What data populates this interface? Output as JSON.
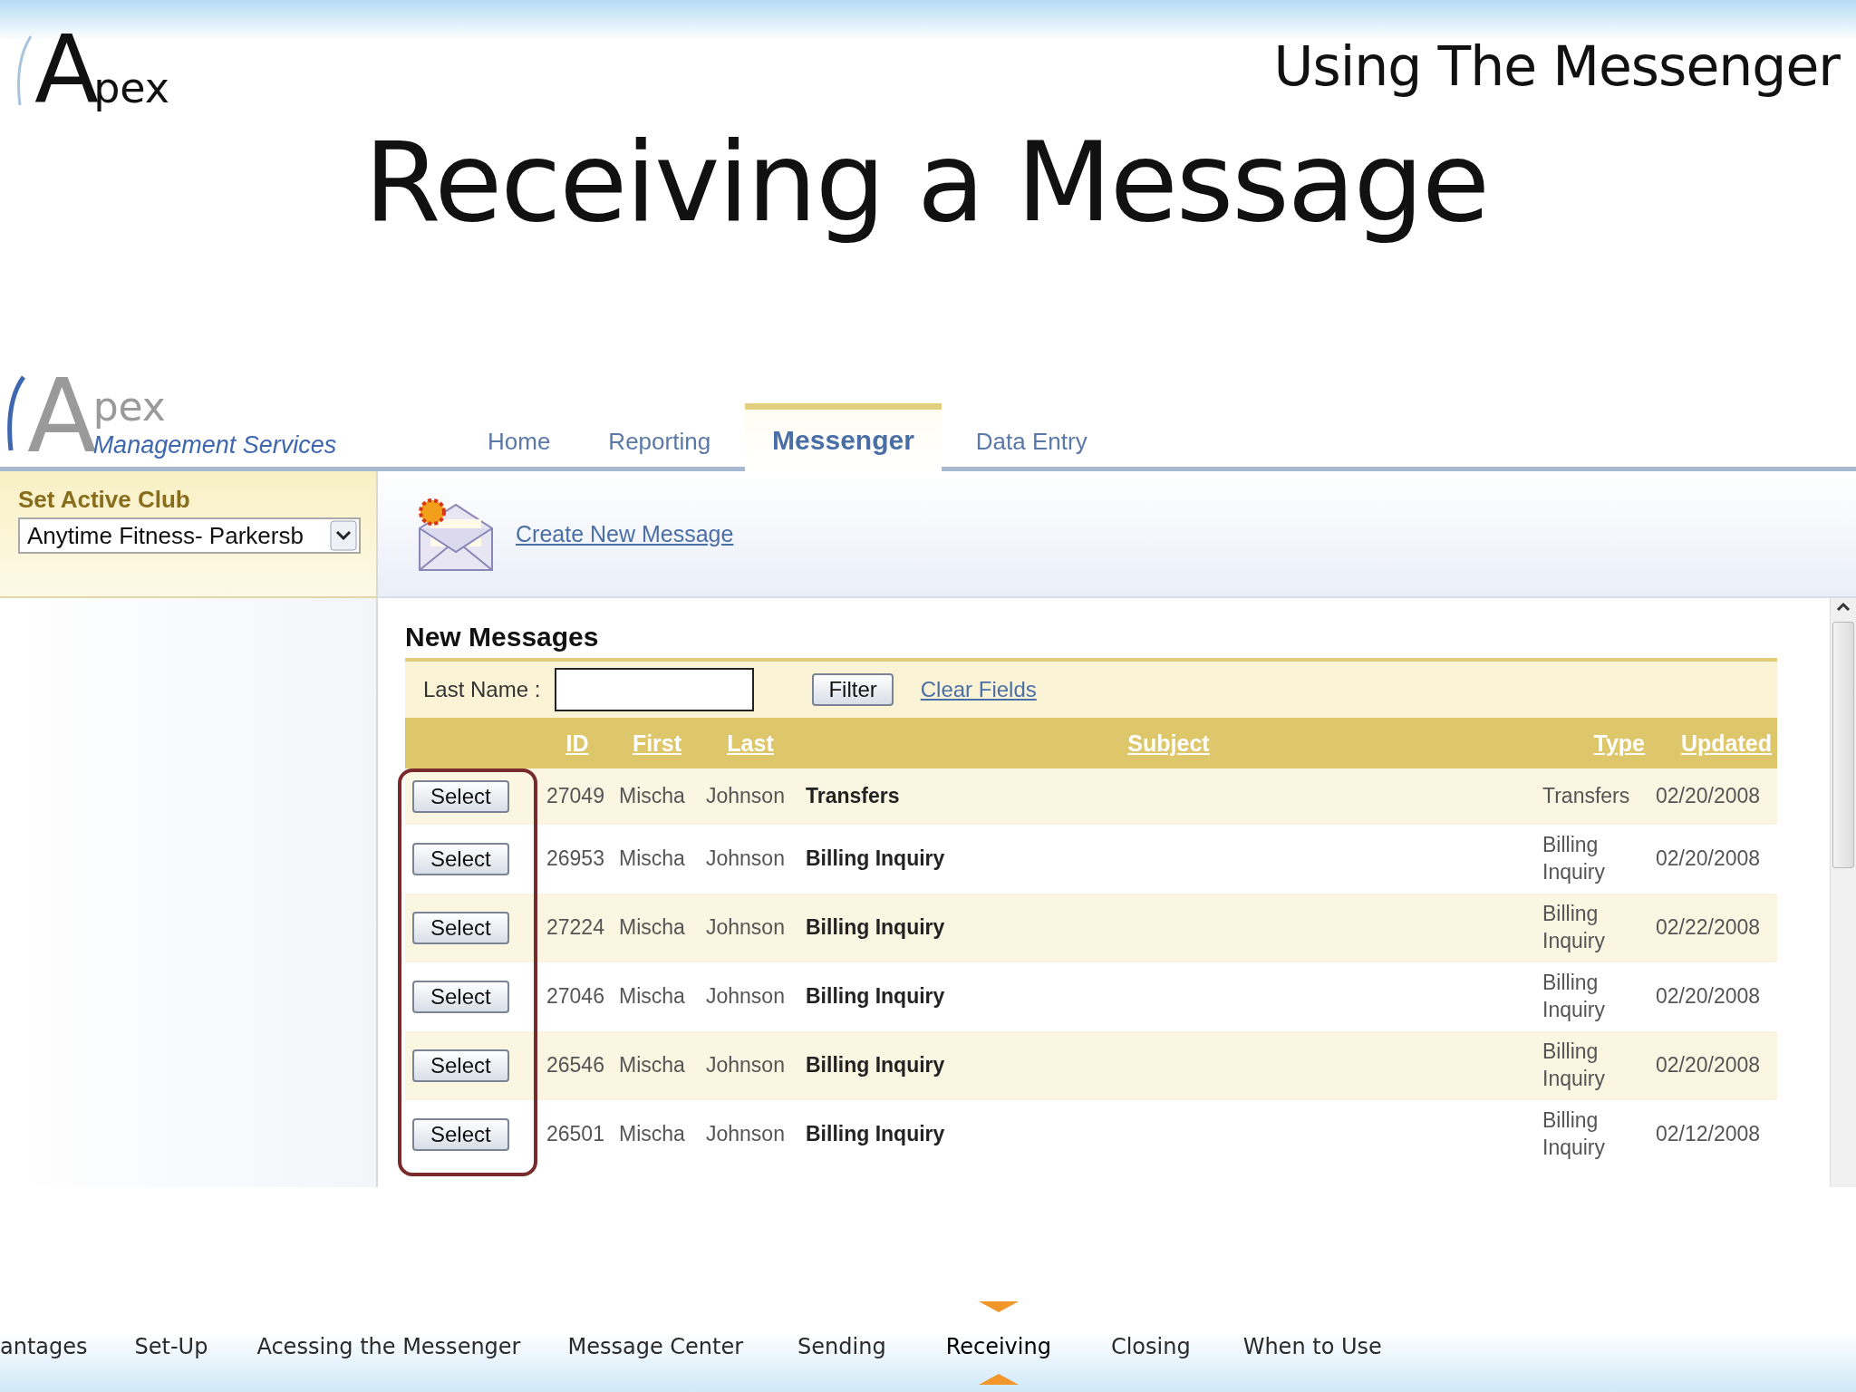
{
  "slide": {
    "logo": {
      "mark": "A",
      "word": "pex"
    },
    "header": "Using The Messenger",
    "title": "Receiving a Message"
  },
  "app": {
    "logo": {
      "mark": "A",
      "word": "pex",
      "subtitle": "Management Services"
    },
    "tabs": [
      {
        "label": "Home",
        "selected": false
      },
      {
        "label": "Reporting",
        "selected": false
      },
      {
        "label": "Messenger",
        "selected": true
      },
      {
        "label": "Data Entry",
        "selected": false
      }
    ],
    "club": {
      "label": "Set Active Club",
      "value": "Anytime Fitness- Parkersb"
    },
    "toolbar": {
      "link": "Create New Message"
    },
    "messages": {
      "title": "New Messages",
      "filter": {
        "label": "Last Name :",
        "button": "Filter",
        "clear": "Clear Fields"
      },
      "columns": [
        "ID",
        "First",
        "Last",
        "Subject",
        "Type",
        "Updated"
      ],
      "rows": [
        {
          "button": "Select",
          "id": "27049",
          "first": "Mischa",
          "last": "Johnson",
          "subject": "Transfers",
          "type": "Transfers",
          "updated": "02/20/2008"
        },
        {
          "button": "Select",
          "id": "26953",
          "first": "Mischa",
          "last": "Johnson",
          "subject": "Billing Inquiry",
          "type": "Billing Inquiry",
          "updated": "02/20/2008"
        },
        {
          "button": "Select",
          "id": "27224",
          "first": "Mischa",
          "last": "Johnson",
          "subject": "Billing Inquiry",
          "type": "Billing Inquiry",
          "updated": "02/22/2008"
        },
        {
          "button": "Select",
          "id": "27046",
          "first": "Mischa",
          "last": "Johnson",
          "subject": "Billing Inquiry",
          "type": "Billing Inquiry",
          "updated": "02/20/2008"
        },
        {
          "button": "Select",
          "id": "26546",
          "first": "Mischa",
          "last": "Johnson",
          "subject": "Billing Inquiry",
          "type": "Billing Inquiry",
          "updated": "02/20/2008"
        },
        {
          "button": "Select",
          "id": "26501",
          "first": "Mischa",
          "last": "Johnson",
          "subject": "Billing Inquiry",
          "type": "Billing Inquiry",
          "updated": "02/12/2008"
        }
      ]
    }
  },
  "nav": {
    "items": [
      {
        "label": "antages",
        "selected": false
      },
      {
        "label": "Set-Up",
        "selected": false
      },
      {
        "label": "Acessing the Messenger",
        "selected": false
      },
      {
        "label": "Message Center",
        "selected": false
      },
      {
        "label": "Sending",
        "selected": false
      },
      {
        "label": "Receiving",
        "selected": true
      },
      {
        "label": "Closing",
        "selected": false
      },
      {
        "label": "When to Use",
        "selected": false
      }
    ]
  }
}
